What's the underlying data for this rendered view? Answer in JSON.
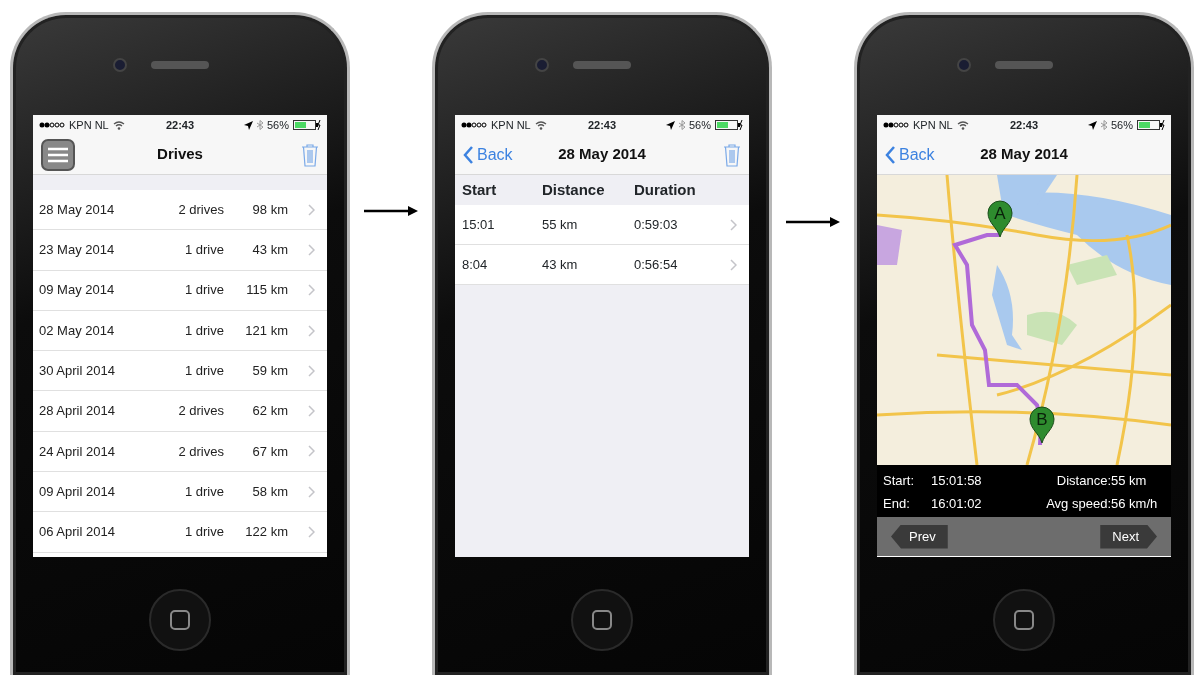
{
  "phones": [
    {
      "kind": "list",
      "status_bar": {
        "carrier": "KPN NL",
        "time": "22:43",
        "battery": "56%"
      },
      "nav": {
        "menu": true,
        "title": "Drives",
        "trash": true
      },
      "rows": [
        {
          "date": "28 May 2014",
          "count": "2 drives",
          "distance": "98 km"
        },
        {
          "date": "23 May 2014",
          "count": "1 drive",
          "distance": "43 km"
        },
        {
          "date": "09 May 2014",
          "count": "1 drive",
          "distance": "115 km"
        },
        {
          "date": "02 May 2014",
          "count": "1 drive",
          "distance": "121 km"
        },
        {
          "date": "30 April 2014",
          "count": "1 drive",
          "distance": "59 km"
        },
        {
          "date": "28 April 2014",
          "count": "2 drives",
          "distance": "62 km"
        },
        {
          "date": "24 April 2014",
          "count": "2 drives",
          "distance": "67 km"
        },
        {
          "date": "09 April 2014",
          "count": "1 drive",
          "distance": "58 km"
        },
        {
          "date": "06 April 2014",
          "count": "1 drive",
          "distance": "122 km"
        }
      ]
    },
    {
      "kind": "table",
      "status_bar": {
        "carrier": "KPN NL",
        "time": "22:43",
        "battery": "56%"
      },
      "nav": {
        "back": "Back",
        "title": "28 May 2014",
        "trash": true
      },
      "columns": [
        "Start",
        "Distance",
        "Duration"
      ],
      "rows": [
        [
          "15:01",
          "55 km",
          "0:59:03"
        ],
        [
          "8:04",
          "43 km",
          "0:56:54"
        ]
      ]
    },
    {
      "kind": "map",
      "status_bar": {
        "carrier": "KPN NL",
        "time": "22:43",
        "battery": "56%"
      },
      "nav": {
        "back": "Back",
        "title": "28 May 2014"
      },
      "pins": [
        "A",
        "B"
      ],
      "info": [
        {
          "label": "Start:",
          "value": "15:01:58"
        },
        {
          "label": "Distance:",
          "value": "55 km"
        },
        {
          "label": "End:",
          "value": "16:01:02"
        },
        {
          "label": "Avg speed:",
          "value": "56 km/h"
        }
      ],
      "prev": "Prev",
      "next": "Next"
    }
  ]
}
